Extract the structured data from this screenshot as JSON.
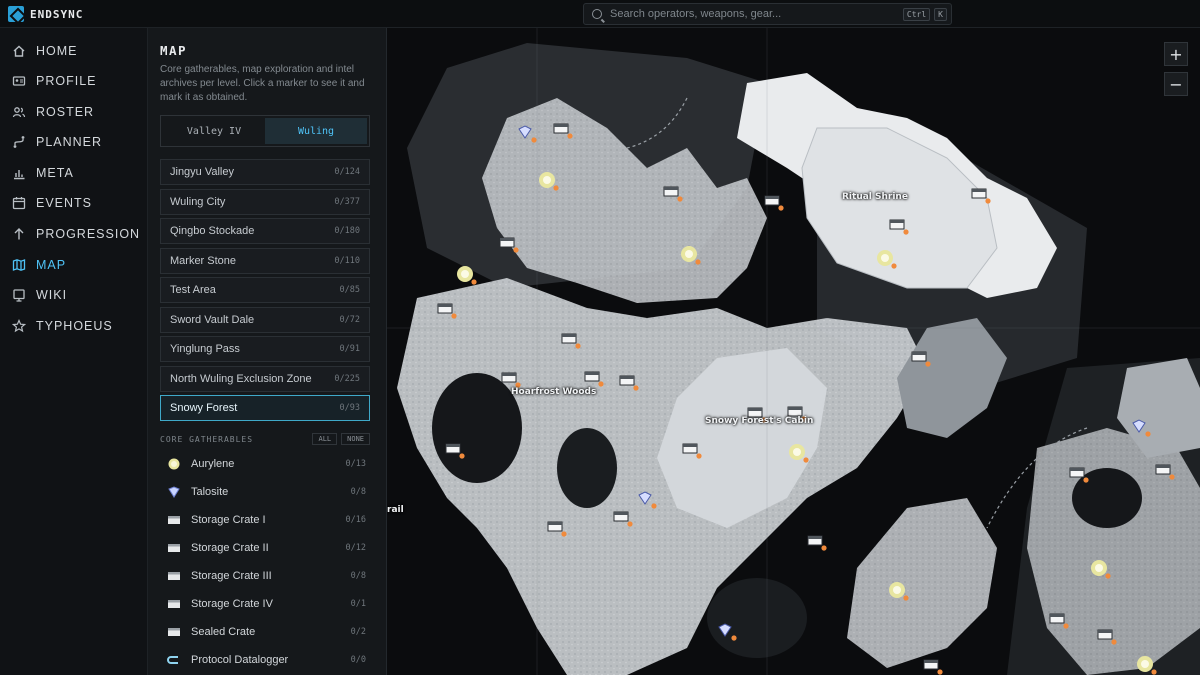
{
  "app": {
    "name": "ENDSYNC"
  },
  "search": {
    "placeholder": "Search operators, weapons, gear...",
    "shortcut_ctrl": "Ctrl",
    "shortcut_key": "K"
  },
  "nav": {
    "items": [
      {
        "label": "HOME",
        "icon": "home-icon"
      },
      {
        "label": "PROFILE",
        "icon": "id-card-icon"
      },
      {
        "label": "ROSTER",
        "icon": "users-icon"
      },
      {
        "label": "PLANNER",
        "icon": "route-icon"
      },
      {
        "label": "META",
        "icon": "bar-chart-icon"
      },
      {
        "label": "EVENTS",
        "icon": "calendar-icon"
      },
      {
        "label": "PROGRESSION",
        "icon": "arrow-up-icon"
      },
      {
        "label": "MAP",
        "icon": "map-icon",
        "active": true
      },
      {
        "label": "WIKI",
        "icon": "book-icon"
      },
      {
        "label": "TYPHOEUS",
        "icon": "star-icon"
      }
    ]
  },
  "panel": {
    "title": "MAP",
    "description": "Core gatherables, map exploration and intel archives per level. Click a marker to see it and mark it as obtained.",
    "tabs": [
      {
        "label": "Valley IV"
      },
      {
        "label": "Wuling",
        "active": true
      }
    ],
    "regions": [
      {
        "name": "Jingyu Valley",
        "count": "0/124"
      },
      {
        "name": "Wuling City",
        "count": "0/377"
      },
      {
        "name": "Qingbo Stockade",
        "count": "0/180"
      },
      {
        "name": "Marker Stone",
        "count": "0/110"
      },
      {
        "name": "Test Area",
        "count": "0/85"
      },
      {
        "name": "Sword Vault Dale",
        "count": "0/72"
      },
      {
        "name": "Yinglung Pass",
        "count": "0/91"
      },
      {
        "name": "North Wuling Exclusion Zone",
        "count": "0/225"
      },
      {
        "name": "Snowy Forest",
        "count": "0/93",
        "active": true
      }
    ],
    "section_title": "CORE GATHERABLES",
    "all_label": "ALL",
    "none_label": "NONE",
    "gatherables": [
      {
        "name": "Aurylene",
        "count": "0/13",
        "icon": "aurylene-icon"
      },
      {
        "name": "Talosite",
        "count": "0/8",
        "icon": "talosite-icon"
      },
      {
        "name": "Storage Crate I",
        "count": "0/16",
        "icon": "crate-icon"
      },
      {
        "name": "Storage Crate II",
        "count": "0/12",
        "icon": "crate-icon"
      },
      {
        "name": "Storage Crate III",
        "count": "0/8",
        "icon": "crate-icon"
      },
      {
        "name": "Storage Crate IV",
        "count": "0/1",
        "icon": "crate-icon"
      },
      {
        "name": "Sealed Crate",
        "count": "0/2",
        "icon": "crate-icon"
      },
      {
        "name": "Protocol Datalogger",
        "count": "0/0",
        "icon": "datalogger-icon"
      }
    ]
  },
  "map": {
    "zoom_in": "+",
    "zoom_out": "−",
    "labels": [
      "Ritual Shrine",
      "Hoarfrost Woods",
      "Snowy Forest's Cabin",
      "rail"
    ]
  },
  "colors": {
    "accent": "#4fc3f7",
    "marker_dot": "#f08a3c",
    "aurylene": "#e8e6a0"
  }
}
